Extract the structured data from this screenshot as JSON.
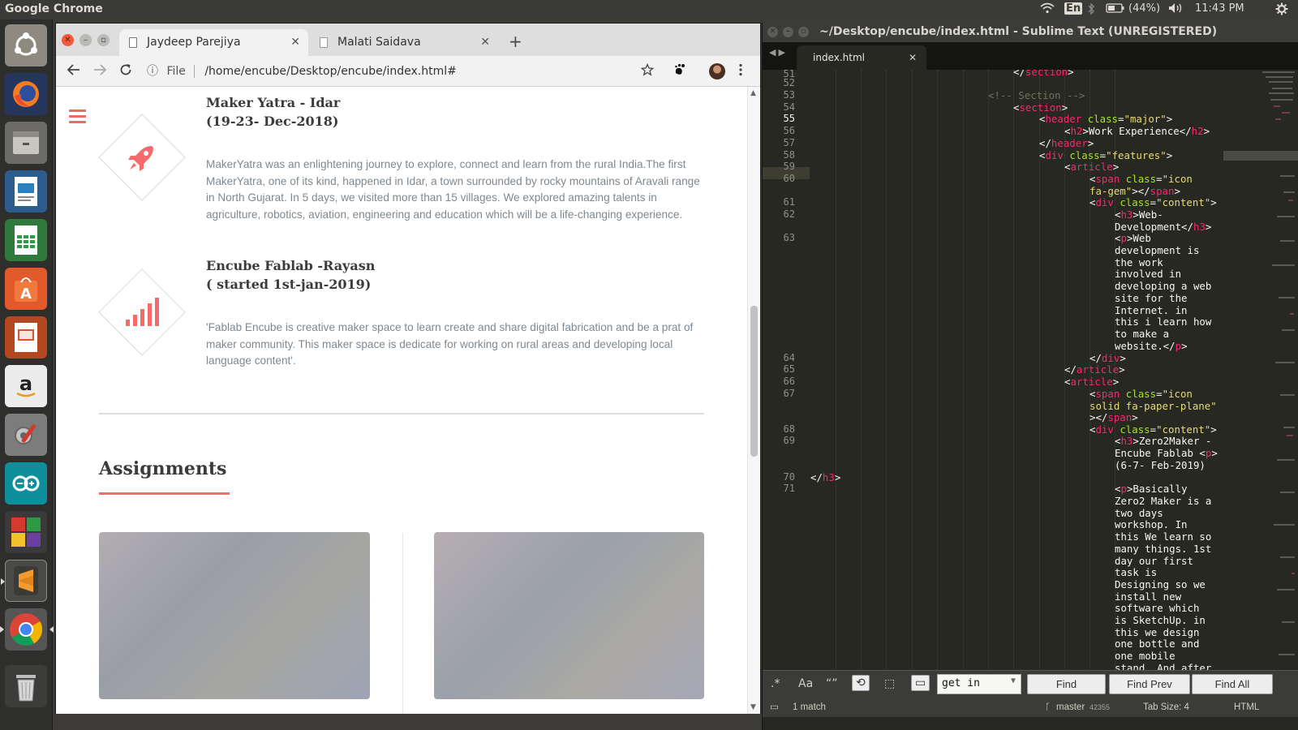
{
  "topbar": {
    "app_title": "Google Chrome",
    "keyboard_layout": "En",
    "battery": "(44%)",
    "time": "11:43 PM"
  },
  "launcher": {
    "items": [
      "ubuntu-dash",
      "firefox",
      "files",
      "libreoffice-writer",
      "libreoffice-calc",
      "ubuntu-software",
      "libreoffice-impress",
      "amazon",
      "system-settings",
      "arduino",
      "mixed-app",
      "sublime-text",
      "google-chrome",
      "trash"
    ]
  },
  "chrome": {
    "tabs": [
      {
        "label": "Jaydeep Parejiya",
        "active": true
      },
      {
        "label": "Malati Saidava",
        "active": false
      }
    ],
    "new_tab": "+",
    "address": {
      "scheme_label": "File",
      "url": "/home/encube/Desktop/encube/index.html#"
    },
    "experiences": [
      {
        "title": "Maker Yatra - Idar",
        "subtitle": "(19-23- Dec-2018)",
        "body": "MakerYatra was an enlightening journey to explore, connect and learn from the rural India.The first MakerYatra, one of its kind, happened in Idar, a town surrounded by rocky mountains of Aravali range in North Gujarat. In 5 days, we visited more than 15 villages. We explored amazing talents in agriculture, robotics, aviation, engineering and education which will be a life-changing experience.",
        "icon": "rocket-icon"
      },
      {
        "title": "Encube Fablab -Rayasn",
        "subtitle": "( started 1st-jan-2019)",
        "body": "'Fablab Encube is creative maker space to learn create and share digital fabrication and be a prat of maker community. This maker space is dedicate for working on rural areas and developing local language content'.",
        "icon": "signal-bars-icon"
      }
    ],
    "section_heading": "Assignments",
    "accent_color": "#f56a6a"
  },
  "sublime": {
    "title": "~/Desktop/encube/index.html - Sublime Text (UNREGISTERED)",
    "tab_label": "index.html",
    "line_numbers": [
      "51",
      "52",
      "53",
      "54",
      "55",
      "56",
      "57",
      "58",
      "59",
      "60",
      "61",
      "62",
      "63",
      "64",
      "65",
      "66",
      "67",
      "68",
      "69",
      "70",
      "71"
    ],
    "current_line": "55",
    "find": {
      "query": "get in",
      "find_label": "Find",
      "find_prev_label": "Find Prev",
      "find_all_label": "Find All",
      "regex_label": ".*",
      "case_label": "Aa",
      "word_label": "“”"
    },
    "status": {
      "matches": "1 match",
      "branch": "master",
      "branch_count": "42355",
      "tab_size": "Tab Size: 4",
      "syntax": "HTML"
    }
  }
}
